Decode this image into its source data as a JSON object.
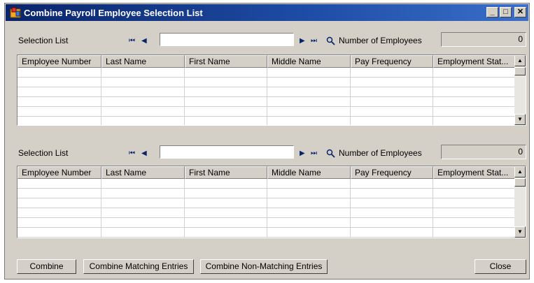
{
  "window": {
    "title": "Combine Payroll Employee Selection List",
    "controls": [
      "_",
      "□",
      "✕"
    ]
  },
  "lists": [
    {
      "label": "Selection List",
      "nav": {
        "first": "⏮",
        "prev": "◀",
        "next": "▶",
        "last": "⏭"
      },
      "search_value": "",
      "count_label": "Number of Employees",
      "count_value": "0",
      "columns": [
        "Employee Number",
        "Last Name",
        "First Name",
        "Middle Name",
        "Pay Frequency",
        "Employment Stat..."
      ]
    },
    {
      "label": "Selection List",
      "nav": {
        "first": "⏮",
        "prev": "◀",
        "next": "▶",
        "last": "⏭"
      },
      "search_value": "",
      "count_label": "Number of Employees",
      "count_value": "0",
      "columns": [
        "Employee Number",
        "Last Name",
        "First Name",
        "Middle Name",
        "Pay Frequency",
        "Employment Stat..."
      ]
    }
  ],
  "scroll": {
    "up": "▲",
    "down": "▼"
  },
  "buttons": {
    "combine": "Combine",
    "combine_matching": "Combine Matching Entries",
    "combine_non_matching": "Combine Non-Matching Entries",
    "close": "Close"
  }
}
